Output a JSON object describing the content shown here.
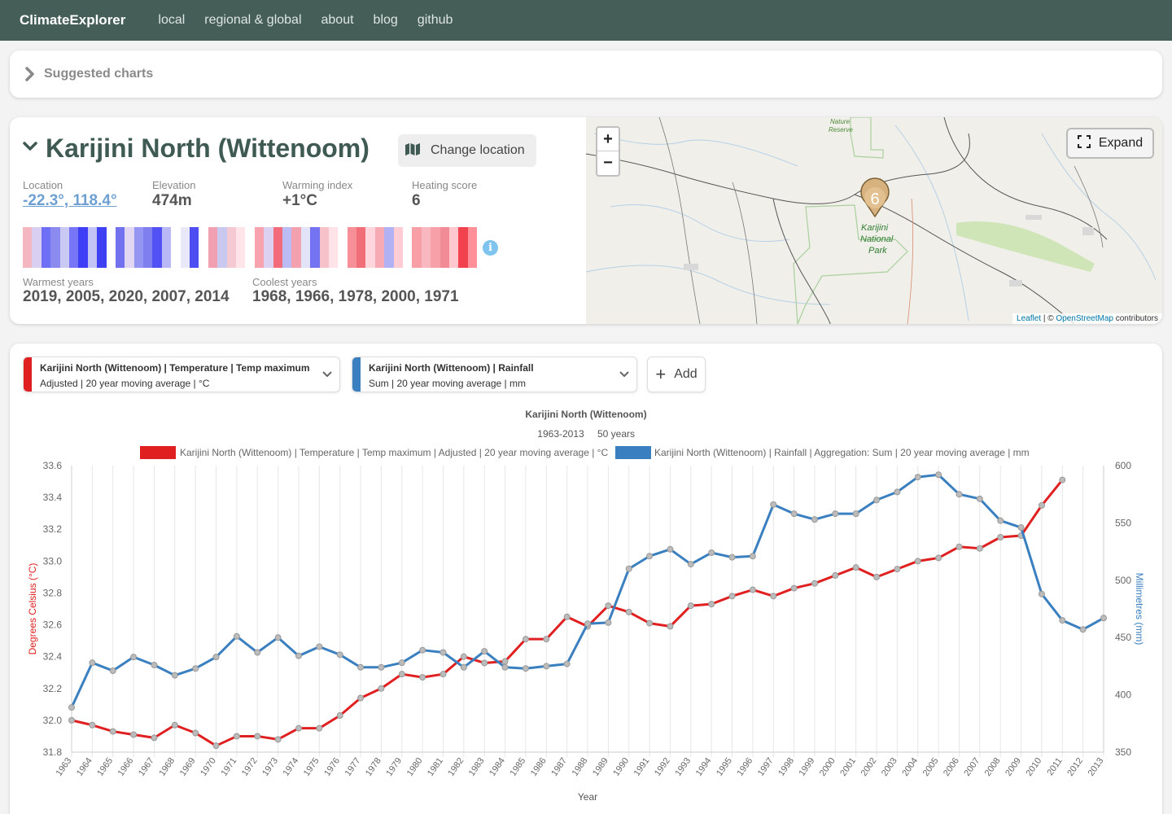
{
  "nav": {
    "brand": "ClimateExplorer",
    "links": [
      "local",
      "regional & global",
      "about",
      "blog",
      "github"
    ]
  },
  "suggested": {
    "label": "Suggested charts"
  },
  "location": {
    "title": "Karijini North (Wittenoom)",
    "change_label": "Change location",
    "stats": [
      {
        "key": "Location",
        "value": "-22.3°, 118.4°"
      },
      {
        "key": "Elevation",
        "value": "474m"
      },
      {
        "key": "Warming index",
        "value": "+1°C"
      },
      {
        "key": "Heating score",
        "value": "6"
      }
    ],
    "warmest_label": "Warmest years",
    "warmest": "2019, 2005, 2020, 2007, 2014",
    "coolest_label": "Coolest years",
    "coolest": "1968, 1966, 1978, 2000, 1971",
    "info_icon": "i",
    "stripe_colors": [
      "#f4b7c1",
      "#d9cff0",
      "#6f6ff5",
      "#8a8aef",
      "#c9c9f3",
      "#7676f6",
      "#3e3ef6",
      "#c2c2f5",
      "#4040f3",
      "#ffffff",
      "#7272ef",
      "#e2d7f2",
      "#9595f3",
      "#7f7fef",
      "#5151f4",
      "#b8b8f6",
      "#ffffff",
      "#e8e8f8",
      "#4d4df2",
      "#ffffff",
      "#f0a0b0",
      "#c9c9f0",
      "#f4c9d2",
      "#ffe5ea",
      "#ffffff",
      "#f7a3ae",
      "#dcd1f1",
      "#f26c7c",
      "#bcbcf4",
      "#f3a1ae",
      "#e3e3f7",
      "#7474f3",
      "#f7c1ca",
      "#ffe3e8",
      "#ffffff",
      "#f78f98",
      "#f06e78",
      "#ffd6dc",
      "#f7aab3",
      "#b1b1f3",
      "#ffccd3",
      "#ffffff",
      "#f79ea6",
      "#f9b8bf",
      "#f7a0a8",
      "#f18c96",
      "#ffc8cf",
      "#f2424f",
      "#ff8f98"
    ]
  },
  "map": {
    "zoom_in": "+",
    "zoom_out": "−",
    "expand_label": "Expand",
    "marker_value": "6",
    "park_label": [
      "Karijini",
      "National",
      "Park"
    ],
    "reserve_label": [
      "Nature",
      "Reserve"
    ],
    "attribution": {
      "leaflet": "Leaflet",
      "sep": " | © ",
      "osm": "OpenStreetMap",
      "tail": " contributors"
    }
  },
  "selectors": [
    {
      "line1": "Karijini North (Wittenoom) | Temperature | Temp maximum",
      "line2": "Adjusted | 20 year moving average | °C",
      "color": "#e02020"
    },
    {
      "line1": "Karijini North (Wittenoom) | Rainfall",
      "line2": "Sum | 20 year moving average | mm",
      "color": "#3a7fc0"
    }
  ],
  "add_label": "Add",
  "chart_data": {
    "type": "line",
    "title": "Karijini North (Wittenoom)",
    "subtitle_range": "1963-2013",
    "subtitle_years": "50 years",
    "xlabel": "Year",
    "ylabel_left": "Degrees Celsius (°C)",
    "ylabel_right": "Millimetres (mm)",
    "ylim_left": [
      31.8,
      33.6
    ],
    "ylim_right": [
      350,
      600
    ],
    "yticks_left": [
      "33.6",
      "33.4",
      "33.2",
      "33.0",
      "32.8",
      "32.6",
      "32.4",
      "32.2",
      "32.0",
      "31.8"
    ],
    "yticks_right": [
      "600",
      "550",
      "500",
      "450",
      "400",
      "350"
    ],
    "x": [
      1963,
      1964,
      1965,
      1966,
      1967,
      1968,
      1969,
      1970,
      1971,
      1972,
      1973,
      1974,
      1975,
      1976,
      1977,
      1978,
      1979,
      1980,
      1981,
      1982,
      1983,
      1984,
      1985,
      1986,
      1987,
      1988,
      1989,
      1990,
      1991,
      1992,
      1993,
      1994,
      1995,
      1996,
      1997,
      1998,
      1999,
      2000,
      2001,
      2002,
      2003,
      2004,
      2005,
      2006,
      2007,
      2008,
      2009,
      2010,
      2011,
      2012,
      2013
    ],
    "series": [
      {
        "name": "Karijini North (Wittenoom) | Temperature | Temp maximum | Adjusted | 20 year moving average | °C",
        "color": "#e02020",
        "axis": "left",
        "values": [
          32.0,
          31.97,
          31.93,
          31.91,
          31.89,
          31.97,
          31.92,
          31.84,
          31.9,
          31.9,
          31.88,
          31.95,
          31.95,
          32.03,
          32.14,
          32.2,
          32.29,
          32.27,
          32.29,
          32.4,
          32.36,
          32.37,
          32.51,
          32.51,
          32.65,
          32.59,
          32.72,
          32.68,
          32.61,
          32.59,
          32.72,
          32.73,
          32.78,
          32.82,
          32.78,
          32.83,
          32.86,
          32.91,
          32.96,
          32.9,
          32.95,
          33.0,
          33.02,
          33.09,
          33.08,
          33.15,
          33.16,
          33.35,
          33.51,
          null,
          null
        ]
      },
      {
        "name": "Karijini North (Wittenoom) | Rainfall | Aggregation: Sum | 20 year moving average | mm",
        "color": "#3a7fc0",
        "axis": "right",
        "values": [
          389,
          428,
          421,
          433,
          426,
          417,
          423,
          433,
          451,
          437,
          450,
          434,
          442,
          435,
          424,
          424,
          428,
          439,
          437,
          424,
          438,
          424,
          423,
          425,
          427,
          462,
          463,
          510,
          521,
          527,
          514,
          524,
          520,
          521,
          566,
          558,
          553,
          558,
          558,
          570,
          577,
          590,
          592,
          575,
          571,
          552,
          546,
          488,
          465,
          457,
          467
        ]
      }
    ]
  }
}
